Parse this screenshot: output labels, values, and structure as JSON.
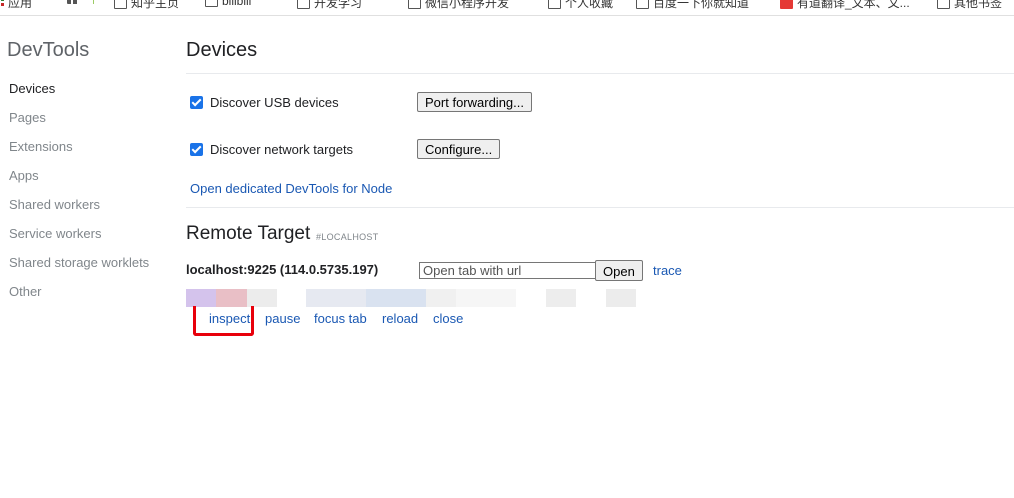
{
  "bookmarks": [
    {
      "label": "应用",
      "icon": "apps-icon"
    },
    {
      "label": "",
      "icon": "grid-icon"
    },
    {
      "label": "知乎主页",
      "icon": "folder-icon"
    },
    {
      "label": "bilibili",
      "icon": "folder-icon"
    },
    {
      "label": "开发学习",
      "icon": "folder-icon"
    },
    {
      "label": "微信小程序开发",
      "icon": "folder-icon"
    },
    {
      "label": "个人收藏",
      "icon": "folder-icon"
    },
    {
      "label": "百度一下你就知道",
      "icon": "folder-icon"
    },
    {
      "label": "有道翻译_文本、文...",
      "icon": "red-app-icon"
    },
    {
      "label": "其他书签",
      "icon": "folder-icon"
    }
  ],
  "sidebar": {
    "title": "DevTools",
    "items": [
      {
        "label": "Devices",
        "active": true
      },
      {
        "label": "Pages"
      },
      {
        "label": "Extensions"
      },
      {
        "label": "Apps"
      },
      {
        "label": "Shared workers"
      },
      {
        "label": "Service workers"
      },
      {
        "label": "Shared storage worklets"
      },
      {
        "label": "Other"
      }
    ]
  },
  "devices": {
    "title": "Devices",
    "usb": {
      "label": "Discover USB devices",
      "checked": true,
      "button": "Port forwarding..."
    },
    "network": {
      "label": "Discover network targets",
      "checked": true,
      "button": "Configure..."
    },
    "node_link": "Open dedicated DevTools for Node"
  },
  "remote": {
    "title": "Remote Target",
    "subtitle": "#LOCALHOST",
    "target": "localhost:9225 (114.0.5735.197)",
    "url_placeholder": "Open tab with url",
    "open_button": "Open",
    "trace_link": "trace",
    "actions": [
      "inspect",
      "pause",
      "focus tab",
      "reload",
      "close"
    ],
    "blurred_colors": [
      "#d4c3ec",
      "#e9bfc6",
      "#ececec",
      "#ffffff",
      "#e6e9f1",
      "#d9e2f0",
      "#f0f0f0",
      "#f6f6f6",
      "#ffffff",
      "#ededed",
      "#ffffff",
      "#ececec"
    ]
  },
  "colors": {
    "accent": "#1a73e8",
    "link": "#1a58b3",
    "highlight": "#e8000b"
  }
}
